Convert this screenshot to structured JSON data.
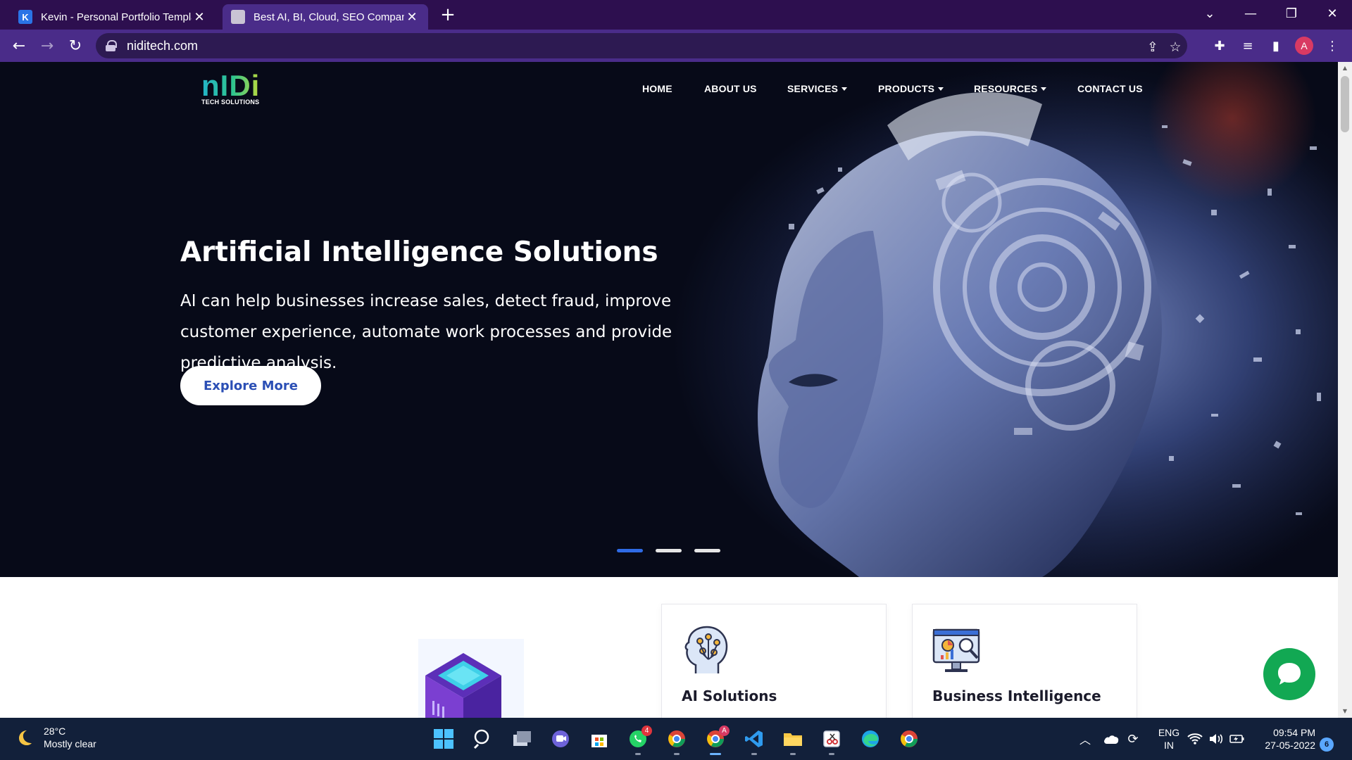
{
  "browser": {
    "tabs": [
      {
        "title": "Kevin - Personal Portfolio Templa",
        "favicon": "K",
        "active": false
      },
      {
        "title": "Best AI, BI, Cloud, SEO Company",
        "favicon": "",
        "active": true
      }
    ],
    "new_tab": "+",
    "url": "niditech.com",
    "profile_initial": "A"
  },
  "site": {
    "logo": {
      "mark": "nIDi",
      "sub": "TECH SOLUTIONS"
    },
    "nav": [
      {
        "label": "HOME",
        "dropdown": false
      },
      {
        "label": "ABOUT US",
        "dropdown": false
      },
      {
        "label": "SERVICES",
        "dropdown": true
      },
      {
        "label": "PRODUCTS",
        "dropdown": true
      },
      {
        "label": "RESOURCES",
        "dropdown": true
      },
      {
        "label": "CONTACT US",
        "dropdown": false
      }
    ],
    "hero": {
      "title": "Artificial Intelligence Solutions",
      "description": "AI can help businesses increase sales, detect fraud, improve customer experience, automate work processes and provide predictive analysis.",
      "cta": "Explore More",
      "slides": 3,
      "active_slide": 1
    },
    "services": [
      {
        "title": "AI Solutions",
        "icon": "ai-head-icon"
      },
      {
        "title": "Business Intelligence",
        "icon": "bi-monitor-icon"
      }
    ],
    "chat_icon": "chat-bubble-icon"
  },
  "taskbar": {
    "weather": {
      "temp": "28°C",
      "condition": "Mostly clear"
    },
    "apps": [
      {
        "name": "start-icon"
      },
      {
        "name": "search-icon"
      },
      {
        "name": "task-view-icon"
      },
      {
        "name": "teams-chat-icon"
      },
      {
        "name": "store-icon"
      },
      {
        "name": "whatsapp-icon",
        "badge": "4"
      },
      {
        "name": "chrome-profile-1-icon"
      },
      {
        "name": "chrome-profile-2-icon",
        "badge": "A"
      },
      {
        "name": "vscode-icon"
      },
      {
        "name": "file-explorer-icon"
      },
      {
        "name": "snipping-tool-icon"
      },
      {
        "name": "edge-icon"
      },
      {
        "name": "chrome-icon"
      }
    ],
    "lang": [
      "ENG",
      "IN"
    ],
    "time": "09:54 PM",
    "date": "27-05-2022",
    "notifications": "6"
  },
  "colors": {
    "tabbar": "#2d0f4f",
    "toolbar": "#4a2c89",
    "accent_blue": "#2f6be6",
    "chat_green": "#12a853",
    "taskbar": "#12203a"
  }
}
